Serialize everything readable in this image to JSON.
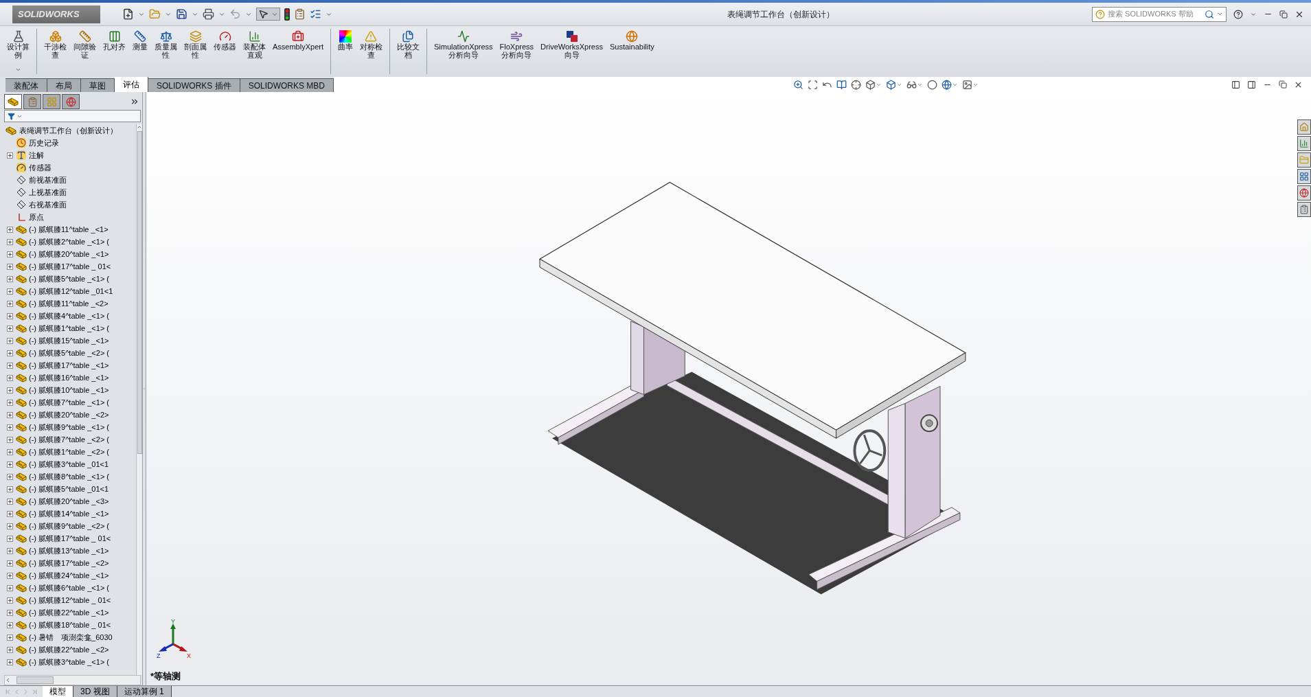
{
  "window": {
    "title": "表绳调节工作台（创新设计）"
  },
  "logo": {
    "text": "SOLIDWORKS"
  },
  "help_search": {
    "placeholder": "搜索 SOLIDWORKS 帮助"
  },
  "command_groups": [
    [
      {
        "lines": [
          "设计算",
          "例"
        ],
        "kind": "dropdown"
      }
    ],
    [
      {
        "lines": [
          "干涉检",
          "查"
        ],
        "kind": "button"
      },
      {
        "lines": [
          "间隙验",
          "证"
        ],
        "kind": "button"
      },
      {
        "lines": [
          "孔对齐"
        ],
        "kind": "button"
      },
      {
        "lines": [
          "测量"
        ],
        "kind": "button"
      },
      {
        "lines": [
          "质量属",
          "性"
        ],
        "kind": "button"
      },
      {
        "lines": [
          "剖面属",
          "性"
        ],
        "kind": "button"
      },
      {
        "lines": [
          "传感器"
        ],
        "kind": "button"
      },
      {
        "lines": [
          "装配体",
          "直观"
        ],
        "kind": "button"
      },
      {
        "lines": [
          "AssemblyXpert"
        ],
        "kind": "button"
      }
    ],
    [
      {
        "lines": [
          "曲率"
        ],
        "kind": "button"
      },
      {
        "lines": [
          "对称检",
          "查"
        ],
        "kind": "button"
      }
    ],
    [
      {
        "lines": [
          "比较文",
          "档"
        ],
        "kind": "button"
      }
    ],
    [
      {
        "lines": [
          "SimulationXpress",
          "分析向导"
        ],
        "kind": "button"
      },
      {
        "lines": [
          "FloXpress",
          "分析向导"
        ],
        "kind": "button"
      },
      {
        "lines": [
          "DriveWorksXpress",
          "向导"
        ],
        "kind": "button"
      },
      {
        "lines": [
          "Sustainability"
        ],
        "kind": "button"
      }
    ]
  ],
  "command_tabs": [
    {
      "label": "装配体",
      "selected": false
    },
    {
      "label": "布局",
      "selected": false
    },
    {
      "label": "草图",
      "selected": false
    },
    {
      "label": "评估",
      "selected": true
    },
    {
      "label": "SOLIDWORKS 插件",
      "selected": false
    },
    {
      "label": "SOLIDWORKS MBD",
      "selected": false
    }
  ],
  "panel_tabs": [
    {
      "selected": true
    },
    {
      "selected": false
    },
    {
      "selected": false
    },
    {
      "selected": false
    }
  ],
  "tree": {
    "root": "表绳调节工作台（创新设计）",
    "items": [
      {
        "kind": "history",
        "label": "历史记录"
      },
      {
        "kind": "annotations",
        "label": "注解",
        "expanded": false
      },
      {
        "kind": "sensors",
        "label": "传感器"
      },
      {
        "kind": "plane",
        "label": "前视基准面"
      },
      {
        "kind": "plane",
        "label": "上视基准面"
      },
      {
        "kind": "plane",
        "label": "右视基准面"
      },
      {
        "kind": "origin",
        "label": "原点"
      },
      {
        "kind": "part",
        "label": "(-) 腻蜞膝11^table _<1>",
        "expanded": false
      },
      {
        "kind": "part",
        "label": "(-) 腻蜞膝2^table _<1> (",
        "expanded": false
      },
      {
        "kind": "part",
        "label": "(-) 腻蜞膝20^table _<1>",
        "expanded": false
      },
      {
        "kind": "part",
        "label": "(-) 腻蜞膝17^table _ 01<",
        "expanded": false
      },
      {
        "kind": "part",
        "label": "(-) 腻蜞膝5^table _<1> (",
        "expanded": false
      },
      {
        "kind": "part",
        "label": "(-) 腻蜞膝12^table _01<1",
        "expanded": false
      },
      {
        "kind": "part",
        "label": "(-) 腻蜞膝11^table _<2>",
        "expanded": false
      },
      {
        "kind": "part",
        "label": "(-) 腻蜞膝4^table _<1> (",
        "expanded": false
      },
      {
        "kind": "part",
        "label": "(-) 腻蜞膝1^table _<1> (",
        "expanded": false
      },
      {
        "kind": "part",
        "label": "(-) 腻蜞膝15^table _<1>",
        "expanded": false
      },
      {
        "kind": "part",
        "label": "(-) 腻蜞膝5^table _<2> (",
        "expanded": false
      },
      {
        "kind": "part",
        "label": "(-) 腻蜞膝17^table _<1>",
        "expanded": false
      },
      {
        "kind": "part",
        "label": "(-) 腻蜞膝16^table _<1>",
        "expanded": false
      },
      {
        "kind": "part",
        "label": "(-) 腻蜞膝10^table _<1>",
        "expanded": false
      },
      {
        "kind": "part",
        "label": "(-) 腻蜞膝7^table _<1> (",
        "expanded": false
      },
      {
        "kind": "part",
        "label": "(-) 腻蜞膝20^table _<2>",
        "expanded": false
      },
      {
        "kind": "part",
        "label": "(-) 腻蜞膝9^table _<1> (",
        "expanded": false
      },
      {
        "kind": "part",
        "label": "(-) 腻蜞膝7^table _<2> (",
        "expanded": false
      },
      {
        "kind": "part",
        "label": "(-) 腻蜞膝1^table _<2> (",
        "expanded": false
      },
      {
        "kind": "part",
        "label": "(-) 腻蜞膝3^table _01<1",
        "expanded": false
      },
      {
        "kind": "part",
        "label": "(-) 腻蜞膝8^table _<1> (",
        "expanded": false
      },
      {
        "kind": "part",
        "label": "(-) 腻蜞膝5^table _01<1",
        "expanded": false
      },
      {
        "kind": "part",
        "label": "(-) 腻蜞膝20^table _<3>",
        "expanded": false
      },
      {
        "kind": "part",
        "label": "(-) 腻蜞膝14^table _<1>",
        "expanded": false
      },
      {
        "kind": "part",
        "label": "(-) 腻蜞膝9^table _<2> (",
        "expanded": false
      },
      {
        "kind": "part",
        "label": "(-) 腻蜞膝17^table _ 01<",
        "expanded": false
      },
      {
        "kind": "part",
        "label": "(-) 腻蜞膝13^table _<1>",
        "expanded": false
      },
      {
        "kind": "part",
        "label": "(-) 腻蜞膝17^table _<2>",
        "expanded": false
      },
      {
        "kind": "part",
        "label": "(-) 腻蜞膝24^table _<1>",
        "expanded": false
      },
      {
        "kind": "part",
        "label": "(-) 腻蜞膝6^table _<1> (",
        "expanded": false
      },
      {
        "kind": "part",
        "label": "(-) 腻蜞膝12^table _ 01<",
        "expanded": false
      },
      {
        "kind": "part",
        "label": "(-) 腻蜞膝22^table _<1>",
        "expanded": false
      },
      {
        "kind": "part",
        "label": "(-) 腻蜞膝18^table _ 01<",
        "expanded": false
      },
      {
        "kind": "part",
        "label": "(-) 暑错　项澍栾龛_6030",
        "expanded": false
      },
      {
        "kind": "part",
        "label": "(-) 腻蜞膝22^table _<2>",
        "expanded": false
      },
      {
        "kind": "part",
        "label": "(-) 腻蜞膝3^table _<1> (",
        "expanded": false
      }
    ]
  },
  "bottom_tabs": [
    {
      "label": "模型",
      "selected": true
    },
    {
      "label": "3D 视图",
      "selected": false
    },
    {
      "label": "运动算例 1",
      "selected": false
    }
  ],
  "viewport": {
    "orientation_label": "*等轴测",
    "triad": {
      "x": "X",
      "y": "Y",
      "z": "Z"
    }
  }
}
